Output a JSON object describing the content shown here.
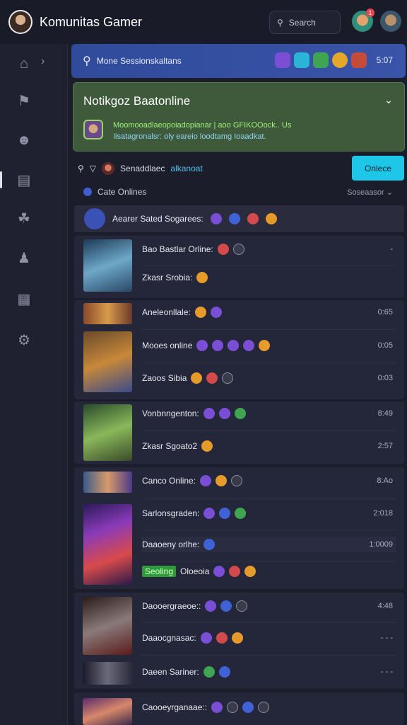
{
  "app": {
    "title": "Komunitas Gamer"
  },
  "header": {
    "search_label": "Search",
    "notif_count": "1"
  },
  "search_bar": {
    "text": "Mone Sessionskaltans",
    "count": "5:07"
  },
  "notice": {
    "title": "Notikgoz Baatonline",
    "line1": "Moomooadlaeopoiadopianar | aoo GFIKOOock.. Us",
    "line2": "Iisatagronalsr: oly eareio loodtamg Ioaadkat."
  },
  "filter": {
    "label": "Senaddlaec",
    "accent": "alkanoat",
    "cta": "Onlece"
  },
  "section": {
    "label": "Cate Onlines",
    "sort": "Soseaasor"
  },
  "group_header": {
    "text": "Aearer Sated Sogarees:"
  },
  "cards": [
    {
      "rows": [
        {
          "text": "Bao Bastlar Orline:",
          "value": "-"
        },
        {
          "text": "Zkasr Srobia:",
          "value": ""
        }
      ]
    },
    {
      "rows": [
        {
          "text": "Aneleonllale:",
          "value": "0:65"
        },
        {
          "text": "Mooes online",
          "value": "0:05"
        },
        {
          "text": "Zaoos Sibia",
          "value": "0:03"
        }
      ]
    },
    {
      "rows": [
        {
          "text": "Vonbnngenton:",
          "value": "8:49"
        },
        {
          "text": "Zkasr Sgoato2",
          "value": "2:57"
        }
      ]
    },
    {
      "rows": [
        {
          "text": "Canco Online:",
          "value": "8:Ao"
        },
        {
          "text": "Sarlonsgraden:",
          "value": "2:018"
        },
        {
          "text": "Daaoeny orlhe:",
          "value": "1:0009"
        },
        {
          "text": "Oloeoia",
          "tag": "Seoling",
          "value": ""
        }
      ]
    },
    {
      "rows": [
        {
          "text": "Daooergraeoe::",
          "value": "4:48"
        },
        {
          "text": "Daaocgnasac:",
          "value": "- - -"
        },
        {
          "text": "Daeen Sariner:",
          "value": "- - -"
        }
      ]
    },
    {
      "rows": [
        {
          "text": "Caooeyrganaae::",
          "value": ""
        }
      ]
    }
  ]
}
